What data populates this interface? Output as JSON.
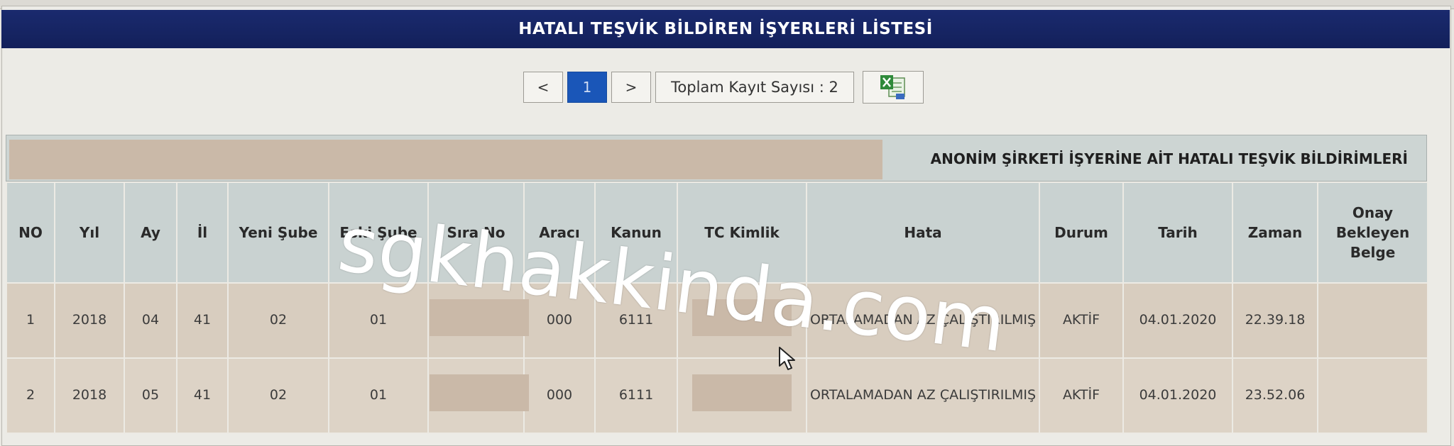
{
  "title": "HATALI TEŞVİK BİLDİREN İŞYERLERİ LİSTESİ",
  "pager": {
    "prev": "<",
    "current": "1",
    "next": ">",
    "total": "Toplam Kayıt Sayısı : 2",
    "excel_icon": "excel-export-icon"
  },
  "table": {
    "caption": "ANONİM ŞİRKETİ İŞYERİNE AİT HATALI TEŞVİK BİLDİRİMLERİ",
    "headers": [
      "NO",
      "Yıl",
      "Ay",
      "İl",
      "Yeni Şube",
      "Eski Şube",
      "Sıra No",
      "Aracı",
      "Kanun",
      "TC Kimlik",
      "Hata",
      "Durum",
      "Tarih",
      "Zaman",
      "Onay Bekleyen Belge"
    ],
    "rows": [
      [
        "1",
        "2018",
        "04",
        "41",
        "02",
        "01",
        "",
        "000",
        "6111",
        "",
        "ORTALAMADAN AZ ÇALIŞTIRILMIŞ",
        "AKTİF",
        "04.01.2020",
        "22.39.18",
        ""
      ],
      [
        "2",
        "2018",
        "05",
        "41",
        "02",
        "01",
        "",
        "000",
        "6111",
        "",
        "ORTALAMADAN AZ ÇALIŞTIRILMIŞ",
        "AKTİF",
        "04.01.2020",
        "23.52.06",
        ""
      ]
    ]
  },
  "watermark": "sgkhakkinda.com",
  "colors": {
    "title_bg": "#1a2a6e",
    "active_page": "#1a56b8",
    "header_bg": "#c9d2d1",
    "row_bg": "#d8cdbf",
    "redaction": "#cab9a8"
  }
}
